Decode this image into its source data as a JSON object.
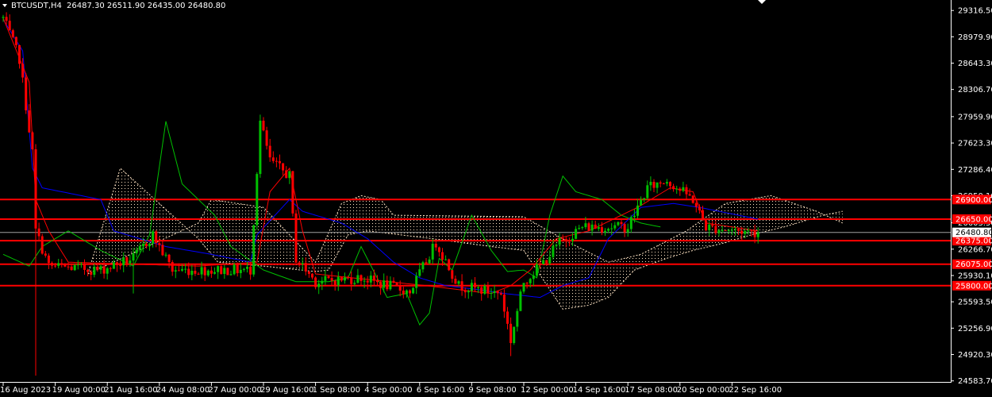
{
  "header": {
    "symbol_text": "BTCUSDT,H4",
    "ohlc_text": "26487.30 26511.90 26435.00 26480.80"
  },
  "colors": {
    "background": "#000000",
    "up": "#00c000",
    "down": "#ff0000",
    "axis": "#ffffff",
    "hline": "#ff0000",
    "tenkan": "#ff0000",
    "kijun": "#0000ff",
    "chikou": "#00c000",
    "cloud": "#ffe4c4",
    "price_tag_bg": "#ffffff",
    "price_tag_fg": "#000000"
  },
  "chart_data": {
    "type": "candlestick",
    "ylim": [
      24560,
      29450
    ],
    "y_ticks": [
      "29316.50",
      "28979.90",
      "28643.30",
      "28306.70",
      "27959.90",
      "27623.30",
      "27286.40",
      "26950.10",
      "26603.50",
      "26266.70",
      "25930.10",
      "25593.50",
      "25256.90",
      "24920.30",
      "24583.70"
    ],
    "x_ticks": [
      {
        "pos": 0,
        "label": "16 Aug 2023"
      },
      {
        "pos": 16,
        "label": "19 Aug 00:00"
      },
      {
        "pos": 32,
        "label": "21 Aug 16:00"
      },
      {
        "pos": 48,
        "label": "24 Aug 08:00"
      },
      {
        "pos": 64,
        "label": "27 Aug 00:00"
      },
      {
        "pos": 80,
        "label": "29 Aug 16:00"
      },
      {
        "pos": 96,
        "label": "1 Sep 08:00"
      },
      {
        "pos": 112,
        "label": "4 Sep 00:00"
      },
      {
        "pos": 128,
        "label": "6 Sep 16:00"
      },
      {
        "pos": 144,
        "label": "9 Sep 08:00"
      },
      {
        "pos": 160,
        "label": "12 Sep 00:00"
      },
      {
        "pos": 176,
        "label": "14 Sep 16:00"
      },
      {
        "pos": 192,
        "label": "17 Sep 08:00"
      },
      {
        "pos": 208,
        "label": "20 Sep 00:00"
      },
      {
        "pos": 224,
        "label": "22 Sep 16:00"
      }
    ],
    "horizontal_lines": [
      {
        "value": 26900.0,
        "label": "26900.00"
      },
      {
        "value": 26650.0,
        "label": "26650.00"
      },
      {
        "value": 26375.0,
        "label": "26375.00"
      },
      {
        "value": 26075.0,
        "label": "26075.00"
      },
      {
        "value": 25800.0,
        "label": "25800.00"
      }
    ],
    "current_price": {
      "value": 26480.8,
      "label": "26480.80"
    },
    "anchors": [
      [
        0,
        29220
      ],
      [
        5,
        28700
      ],
      [
        9,
        27500
      ],
      [
        10,
        26500
      ],
      [
        14,
        26050
      ],
      [
        30,
        26000
      ],
      [
        40,
        26150
      ],
      [
        46,
        26450
      ],
      [
        52,
        26000
      ],
      [
        60,
        26000
      ],
      [
        68,
        26000
      ],
      [
        76,
        26000
      ],
      [
        79,
        27900
      ],
      [
        82,
        27400
      ],
      [
        88,
        27200
      ],
      [
        90,
        26150
      ],
      [
        96,
        25850
      ],
      [
        110,
        25900
      ],
      [
        125,
        25720
      ],
      [
        133,
        26350
      ],
      [
        140,
        25800
      ],
      [
        153,
        25700
      ],
      [
        156,
        25100
      ],
      [
        160,
        25850
      ],
      [
        166,
        26100
      ],
      [
        171,
        26350
      ],
      [
        178,
        26550
      ],
      [
        192,
        26550
      ],
      [
        198,
        27050
      ],
      [
        204,
        27150
      ],
      [
        212,
        26900
      ],
      [
        216,
        26550
      ],
      [
        226,
        26500
      ],
      [
        232,
        26480.8
      ]
    ],
    "tenkan": [
      [
        0,
        29220
      ],
      [
        8,
        28400
      ],
      [
        10,
        26900
      ],
      [
        14,
        26500
      ],
      [
        20,
        26100
      ],
      [
        60,
        26050
      ],
      [
        78,
        26100
      ],
      [
        82,
        27000
      ],
      [
        88,
        27300
      ],
      [
        92,
        26500
      ],
      [
        96,
        25950
      ],
      [
        130,
        25800
      ],
      [
        150,
        25700
      ],
      [
        156,
        25800
      ],
      [
        162,
        26000
      ],
      [
        170,
        26400
      ],
      [
        180,
        26500
      ],
      [
        195,
        26800
      ],
      [
        205,
        27050
      ],
      [
        212,
        27000
      ],
      [
        216,
        26600
      ],
      [
        232,
        26500
      ]
    ],
    "kijun": [
      [
        0,
        29200
      ],
      [
        6,
        28800
      ],
      [
        9,
        27300
      ],
      [
        12,
        27050
      ],
      [
        24,
        26950
      ],
      [
        30,
        26900
      ],
      [
        34,
        26500
      ],
      [
        50,
        26300
      ],
      [
        64,
        26200
      ],
      [
        76,
        26100
      ],
      [
        78,
        26450
      ],
      [
        88,
        26900
      ],
      [
        92,
        26750
      ],
      [
        96,
        26700
      ],
      [
        104,
        26600
      ],
      [
        112,
        26400
      ],
      [
        120,
        26100
      ],
      [
        128,
        25900
      ],
      [
        136,
        25800
      ],
      [
        146,
        25750
      ],
      [
        154,
        25700
      ],
      [
        165,
        25650
      ],
      [
        172,
        25800
      ],
      [
        180,
        25900
      ],
      [
        186,
        26400
      ],
      [
        196,
        26800
      ],
      [
        206,
        26850
      ],
      [
        214,
        26800
      ],
      [
        232,
        26650
      ]
    ],
    "chikou": [
      [
        0,
        26200
      ],
      [
        8,
        26050
      ],
      [
        12,
        26300
      ],
      [
        20,
        26500
      ],
      [
        30,
        26250
      ],
      [
        40,
        26050
      ],
      [
        45,
        26450
      ],
      [
        50,
        27900
      ],
      [
        55,
        27100
      ],
      [
        60,
        26900
      ],
      [
        65,
        26700
      ],
      [
        70,
        26300
      ],
      [
        80,
        26000
      ],
      [
        90,
        25850
      ],
      [
        100,
        25850
      ],
      [
        106,
        25900
      ],
      [
        110,
        26300
      ],
      [
        118,
        25650
      ],
      [
        124,
        25700
      ],
      [
        128,
        25300
      ],
      [
        131,
        25450
      ],
      [
        134,
        26150
      ],
      [
        138,
        26000
      ],
      [
        144,
        26700
      ],
      [
        150,
        26250
      ],
      [
        155,
        25980
      ],
      [
        160,
        26000
      ],
      [
        164,
        25900
      ],
      [
        168,
        26700
      ],
      [
        172,
        27200
      ],
      [
        176,
        27000
      ],
      [
        184,
        26900
      ],
      [
        190,
        26700
      ],
      [
        196,
        26600
      ],
      [
        202,
        26550
      ]
    ],
    "span_a": [
      [
        26,
        25950
      ],
      [
        60,
        26600
      ],
      [
        64,
        26900
      ],
      [
        80,
        26800
      ],
      [
        96,
        26100
      ],
      [
        104,
        26850
      ],
      [
        110,
        26950
      ],
      [
        116,
        26900
      ],
      [
        120,
        26700
      ],
      [
        160,
        26680
      ],
      [
        174,
        26350
      ],
      [
        186,
        26100
      ],
      [
        196,
        26200
      ],
      [
        210,
        26500
      ],
      [
        222,
        26850
      ],
      [
        236,
        26950
      ],
      [
        250,
        26750
      ],
      [
        258,
        26600
      ]
    ],
    "span_b": [
      [
        26,
        25950
      ],
      [
        36,
        27300
      ],
      [
        60,
        26400
      ],
      [
        66,
        26100
      ],
      [
        80,
        26050
      ],
      [
        96,
        25980
      ],
      [
        100,
        26000
      ],
      [
        106,
        26450
      ],
      [
        112,
        26500
      ],
      [
        132,
        26400
      ],
      [
        150,
        26300
      ],
      [
        160,
        26250
      ],
      [
        172,
        25500
      ],
      [
        180,
        25550
      ],
      [
        186,
        25650
      ],
      [
        194,
        26000
      ],
      [
        204,
        26150
      ],
      [
        212,
        26250
      ],
      [
        222,
        26350
      ],
      [
        230,
        26450
      ],
      [
        240,
        26550
      ],
      [
        252,
        26700
      ],
      [
        258,
        26750
      ]
    ]
  }
}
